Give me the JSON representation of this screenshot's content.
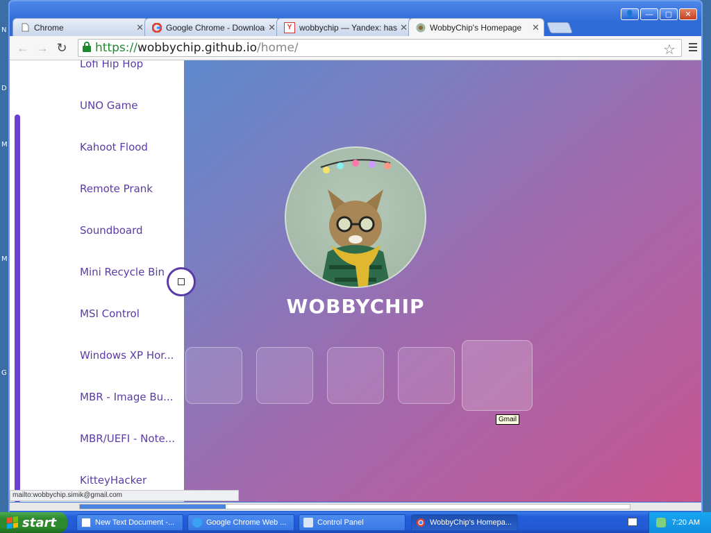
{
  "desktop_letters": [
    "N",
    "D",
    "M",
    "M",
    "G"
  ],
  "window": {
    "caption_buttons": [
      "👤",
      "—",
      "▢",
      "✕"
    ]
  },
  "tabs": [
    {
      "title": "Chrome",
      "icon": "page-icon",
      "active": false
    },
    {
      "title": "Google Chrome - Download t",
      "icon": "google-icon",
      "active": false
    },
    {
      "title": "wobbychip — Yandex: has fo",
      "icon": "yandex-icon",
      "active": false
    },
    {
      "title": "WobbyChip's Homepage",
      "icon": "cat-avatar-icon",
      "active": true
    }
  ],
  "address": {
    "scheme": "https://",
    "host": "wobbychip.github.io",
    "path": "/home/"
  },
  "sidebar": {
    "items": [
      "Lofi Hip Hop",
      "UNO Game",
      "Kahoot Flood",
      "Remote Prank",
      "Soundboard",
      "Mini Recycle Bin",
      "MSI Control",
      "Windows XP Hor...",
      "MBR - Image Bu...",
      "MBR/UEFI - Note...",
      "KitteyHacker"
    ]
  },
  "main": {
    "brand": "WOBBYCHIP",
    "tooltip": "Gmail"
  },
  "status_bar": "mailto:wobbychip.simik@gmail.com",
  "taskbar": {
    "start_label": "start",
    "tasks": [
      {
        "label": "New Text Document -...",
        "active": false
      },
      {
        "label": "Google Chrome Web ...",
        "active": false
      },
      {
        "label": "Control Panel",
        "active": false
      },
      {
        "label": "WobbyChip's Homepa...",
        "active": true
      }
    ],
    "clock": "7:20 AM"
  },
  "colors": {
    "accent": "#5a3ba6",
    "gradient_start": "#4a8fd6",
    "gradient_end": "#c85590"
  }
}
